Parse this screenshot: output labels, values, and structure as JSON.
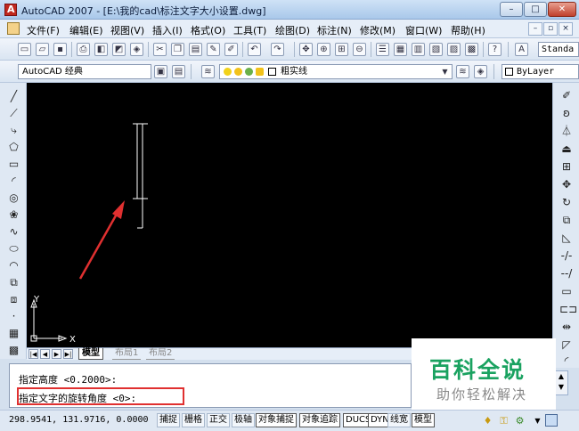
{
  "window": {
    "title": "AutoCAD 2007 - [E:\\我的cad\\标注文字大小设置.dwg]",
    "minimize": "–",
    "maximize": "□",
    "close": "✕"
  },
  "menu": {
    "items": [
      "文件(F)",
      "编辑(E)",
      "视图(V)",
      "插入(I)",
      "格式(O)",
      "工具(T)",
      "绘图(D)",
      "标注(N)",
      "修改(M)",
      "窗口(W)",
      "帮助(H)"
    ],
    "mdi_minimize": "–",
    "mdi_restore": "▫",
    "mdi_close": "×"
  },
  "toolbar": {
    "text_style": "Standa"
  },
  "workspace_toolbar": {
    "workspace": "AutoCAD 经典",
    "layer": "粗实线",
    "linetype": "ByLayer"
  },
  "layout_tabs": {
    "model": "模型",
    "layout1": "布局1",
    "layout2": "布局2"
  },
  "ucs": {
    "x": "X",
    "y": "Y"
  },
  "command_line": {
    "lines": [
      "指定高度 <0.2000>:",
      "指定文字的旋转角度 <0>:"
    ]
  },
  "status_bar": {
    "coordinates": "298.9541, 131.9716, 0.0000",
    "toggles": [
      "捕捉",
      "栅格",
      "正交",
      "极轴",
      "对象捕捉",
      "对象追踪",
      "DUCS",
      "DYN",
      "线宽",
      "模型"
    ]
  },
  "watermark": {
    "title": "百科全说",
    "subtitle": "助你轻松解决"
  },
  "colors": {
    "canvas": "#000000",
    "arrow": "#e03030",
    "highlight_box": "#e03030",
    "watermark_green": "#1aa260"
  }
}
